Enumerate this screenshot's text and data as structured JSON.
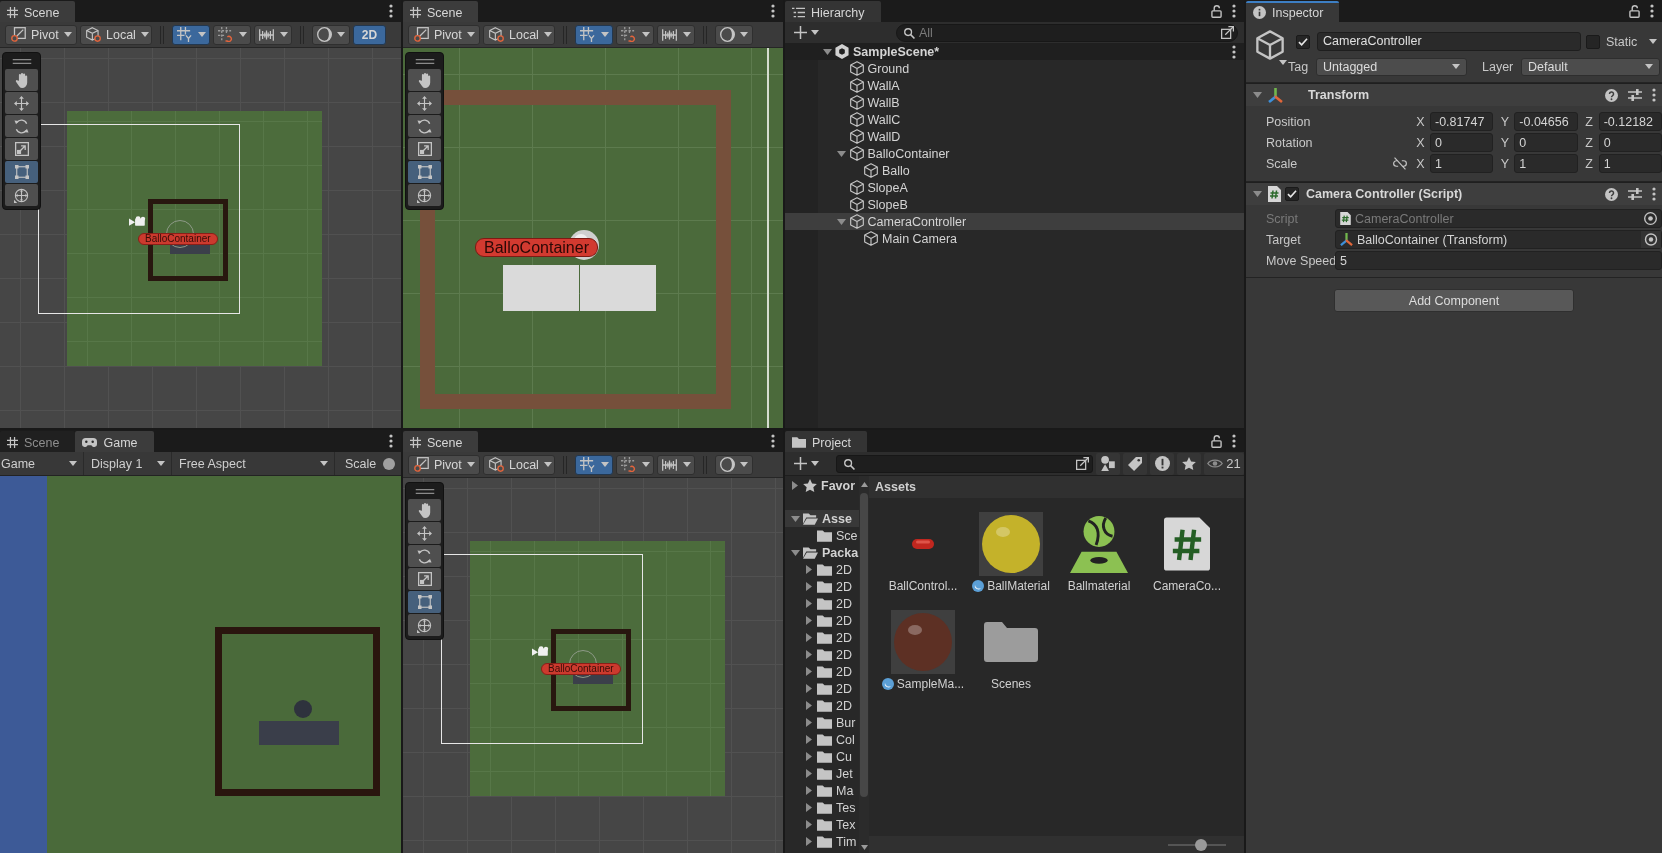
{
  "scene_views": [
    {
      "tabs": [
        {
          "kind": "scene",
          "label": "Scene",
          "selected": true,
          "focused": false
        }
      ],
      "toolbar": [
        {
          "kind": "pivot",
          "label": "Pivot"
        },
        {
          "kind": "space",
          "label": "Local"
        },
        {
          "kind": "grid",
          "on": true
        },
        {
          "kind": "snap",
          "on": false
        },
        {
          "kind": "increment",
          "on": false
        },
        {
          "kind": "shading"
        },
        {
          "kind": "view_2d",
          "label": "2D",
          "on": true
        }
      ],
      "tools": [
        {
          "kind": "hand",
          "selected": false
        },
        {
          "kind": "move",
          "selected": false
        },
        {
          "kind": "rotate",
          "selected": false
        },
        {
          "kind": "scale",
          "selected": false
        },
        {
          "kind": "rect",
          "selected": true
        },
        {
          "kind": "transform",
          "selected": false
        }
      ],
      "kind": "overview",
      "object_label": "BalloContainer"
    },
    {
      "tabs": [
        {
          "kind": "scene",
          "label": "Scene",
          "selected": true,
          "focused": false
        }
      ],
      "toolbar": [
        {
          "kind": "pivot",
          "label": "Pivot"
        },
        {
          "kind": "space",
          "label": "Local"
        },
        {
          "kind": "grid",
          "on": true
        },
        {
          "kind": "snap",
          "on": false
        },
        {
          "kind": "increment",
          "on": false
        },
        {
          "kind": "shading"
        }
      ],
      "tools": [
        {
          "kind": "hand",
          "selected": false
        },
        {
          "kind": "move",
          "selected": false
        },
        {
          "kind": "rotate",
          "selected": false
        },
        {
          "kind": "scale",
          "selected": false
        },
        {
          "kind": "rect",
          "selected": true
        },
        {
          "kind": "transform",
          "selected": false
        }
      ],
      "kind": "closeup",
      "object_label": "BalloContainer"
    },
    {
      "tabs": [
        {
          "kind": "scene",
          "label": "Scene",
          "selected": true,
          "focused": false
        }
      ],
      "toolbar": [
        {
          "kind": "pivot",
          "label": "Pivot"
        },
        {
          "kind": "space",
          "label": "Local"
        },
        {
          "kind": "grid",
          "on": true
        },
        {
          "kind": "snap",
          "on": false
        },
        {
          "kind": "increment",
          "on": false
        },
        {
          "kind": "shading"
        }
      ],
      "tools": [
        {
          "kind": "hand",
          "selected": false
        },
        {
          "kind": "move",
          "selected": false
        },
        {
          "kind": "rotate",
          "selected": false
        },
        {
          "kind": "scale",
          "selected": false
        },
        {
          "kind": "rect",
          "selected": true
        },
        {
          "kind": "transform",
          "selected": false
        }
      ],
      "kind": "overview",
      "object_label": "BalloContainer"
    }
  ],
  "game_view": {
    "tabs": [
      {
        "kind": "scene",
        "label": "Scene",
        "selected": false,
        "focused": false
      },
      {
        "kind": "game",
        "label": "Game",
        "selected": true,
        "focused": false
      }
    ],
    "toolbar": [
      {
        "kind": "dropdown",
        "label": "Game"
      },
      {
        "kind": "dropdown",
        "label": "Display 1"
      },
      {
        "kind": "dropdown",
        "label": "Free Aspect"
      },
      {
        "kind": "slider",
        "label": "Scale"
      }
    ]
  },
  "hierarchy": {
    "tabs": [
      {
        "kind": "hierarchy",
        "label": "Hierarchy",
        "selected": true,
        "focused": false
      }
    ],
    "search": {
      "placeholder": "All"
    },
    "scene": {
      "name": "SampleScene*",
      "selected": false,
      "expanded": true,
      "children": [
        {
          "name": "Ground",
          "selected": false
        },
        {
          "name": "WallA",
          "selected": false
        },
        {
          "name": "WallB",
          "selected": false
        },
        {
          "name": "WallC",
          "selected": false
        },
        {
          "name": "WallD",
          "selected": false
        },
        {
          "name": "BalloContainer",
          "selected": false,
          "expanded": true,
          "children": [
            {
              "name": "Ballo",
              "selected": false
            }
          ]
        },
        {
          "name": "SlopeA",
          "selected": false
        },
        {
          "name": "SlopeB",
          "selected": false
        },
        {
          "name": "CameraController",
          "selected": true,
          "expanded": true,
          "children": [
            {
              "name": "Main Camera",
              "selected": false
            }
          ]
        }
      ]
    }
  },
  "project": {
    "tabs": [
      {
        "kind": "project",
        "label": "Project",
        "selected": true,
        "focused": false
      }
    ],
    "visibility_count": "21",
    "tree": [
      {
        "kind": "favorites",
        "name": "Favor",
        "expanded": false,
        "selected": false
      },
      {
        "kind": "folder",
        "name": "Asse",
        "expanded": true,
        "selected": true,
        "children": [
          {
            "kind": "folder",
            "name": "Sce",
            "selected": false
          }
        ]
      },
      {
        "kind": "folder",
        "name": "Packa",
        "expanded": true,
        "selected": false,
        "children": [
          {
            "kind": "folder",
            "name": "2D",
            "expanded": false,
            "selected": false
          },
          {
            "kind": "folder",
            "name": "2D",
            "expanded": false,
            "selected": false
          },
          {
            "kind": "folder",
            "name": "2D",
            "expanded": false,
            "selected": false
          },
          {
            "kind": "folder",
            "name": "2D",
            "expanded": false,
            "selected": false
          },
          {
            "kind": "folder",
            "name": "2D",
            "expanded": false,
            "selected": false
          },
          {
            "kind": "folder",
            "name": "2D",
            "expanded": false,
            "selected": false
          },
          {
            "kind": "folder",
            "name": "2D",
            "expanded": false,
            "selected": false
          },
          {
            "kind": "folder",
            "name": "2D",
            "expanded": false,
            "selected": false
          },
          {
            "kind": "folder",
            "name": "2D",
            "expanded": false,
            "selected": false
          },
          {
            "kind": "folder",
            "name": "Bur",
            "expanded": false,
            "selected": false
          },
          {
            "kind": "folder",
            "name": "Col",
            "expanded": false,
            "selected": false
          },
          {
            "kind": "folder",
            "name": "Cu",
            "expanded": false,
            "selected": false
          },
          {
            "kind": "folder",
            "name": "Jet",
            "expanded": false,
            "selected": false
          },
          {
            "kind": "folder",
            "name": "Ma",
            "expanded": false,
            "selected": false
          },
          {
            "kind": "folder",
            "name": "Tes",
            "expanded": false,
            "selected": false
          },
          {
            "kind": "folder",
            "name": "Tex",
            "expanded": false,
            "selected": false
          },
          {
            "kind": "folder",
            "name": "Tim",
            "expanded": false,
            "selected": false
          }
        ]
      }
    ],
    "breadcrumb": "Assets",
    "assets": [
      {
        "kind": "prefab",
        "name": "BallControl...",
        "selected": false
      },
      {
        "kind": "material",
        "name": "BallMaterial",
        "color": "#c4b22a",
        "selected": false
      },
      {
        "kind": "physic_material",
        "name": "Ballmaterial",
        "selected": false
      },
      {
        "kind": "script",
        "name": "CameraCo...",
        "selected": false
      },
      {
        "kind": "material",
        "name": "SampleMa...",
        "color": "#5d3024",
        "selected": false
      },
      {
        "kind": "folder",
        "name": "Scenes",
        "selected": false
      }
    ],
    "icon_size": {
      "level": 0.57
    }
  },
  "inspector": {
    "tabs": [
      {
        "kind": "inspector",
        "label": "Inspector",
        "selected": true,
        "focused": true
      }
    ],
    "object": {
      "active": true,
      "name": "CameraController",
      "static": false,
      "static_label": "Static",
      "tag_label": "Tag",
      "tag": "Untagged",
      "layer_label": "Layer",
      "layer": "Default"
    },
    "components": [
      {
        "kind": "transform",
        "title": "Transform",
        "expanded": true,
        "rows": [
          {
            "kind": "vector",
            "label": "Position",
            "values": [
              {
                "axis": "X",
                "value": "-0.81747"
              },
              {
                "axis": "Y",
                "value": "-0.04656"
              },
              {
                "axis": "Z",
                "value": "-0.12182"
              }
            ]
          },
          {
            "kind": "vector",
            "label": "Rotation",
            "values": [
              {
                "axis": "X",
                "value": "0"
              },
              {
                "axis": "Y",
                "value": "0"
              },
              {
                "axis": "Z",
                "value": "0"
              }
            ]
          },
          {
            "kind": "scale",
            "label": "Scale",
            "values": [
              {
                "axis": "X",
                "value": "1"
              },
              {
                "axis": "Y",
                "value": "1"
              },
              {
                "axis": "Z",
                "value": "1"
              }
            ]
          }
        ]
      },
      {
        "kind": "script",
        "title": "Camera Controller (Script)",
        "enabled": true,
        "expanded": true,
        "rows": [
          {
            "kind": "script_ref",
            "label": "Script",
            "value": "CameraController",
            "disabled": true
          },
          {
            "kind": "object_ref",
            "label": "Target",
            "value": "BalloContainer (Transform)",
            "disabled": false
          },
          {
            "kind": "number",
            "label": "Move Speed",
            "value": "5",
            "disabled": false
          }
        ]
      }
    ],
    "add_button": "Add Component"
  }
}
